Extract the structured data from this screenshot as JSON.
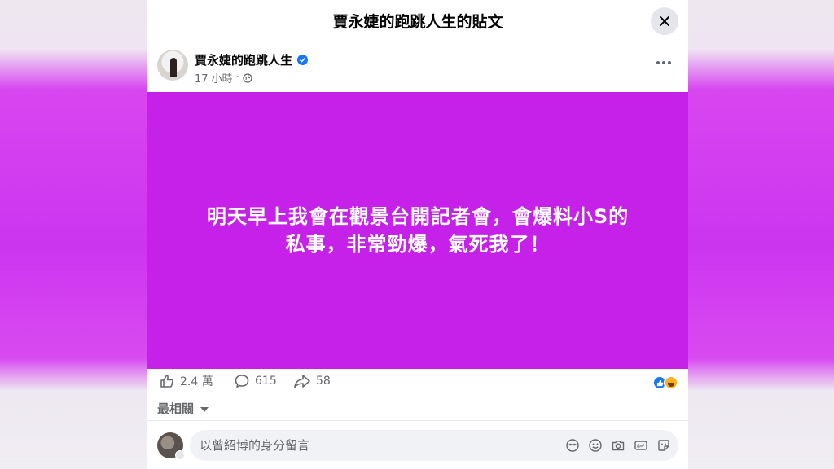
{
  "dialog": {
    "title": "賈永婕的跑跳人生的貼文"
  },
  "post": {
    "author": "賈永婕的跑跳人生",
    "time": "17 小時",
    "separator": "·",
    "text_line1": "明天早上我會在觀景台開記者會，會爆料小S的",
    "text_line2": "私事，非常勁爆，氣死我了！",
    "background_color": "#c521e8"
  },
  "stats": {
    "likes": "2.4 萬",
    "comments": "615",
    "shares": "58"
  },
  "comments": {
    "sort_label": "最相關"
  },
  "composer": {
    "placeholder": "以曾紹博的身分留言"
  },
  "icons": {
    "close": "close-icon",
    "verified": "verified-badge-icon",
    "globe": "globe-icon",
    "more": "more-options-icon",
    "like": "thumbs-up-icon",
    "comment": "comment-bubble-icon",
    "share": "share-arrow-icon",
    "avatar_sticker": "avatar-sticker-icon",
    "emoji": "emoji-icon",
    "camera": "camera-icon",
    "gif": "gif-icon",
    "sticker": "sticker-icon"
  },
  "colors": {
    "accent": "#1877f2",
    "muted_text": "#65676b"
  }
}
